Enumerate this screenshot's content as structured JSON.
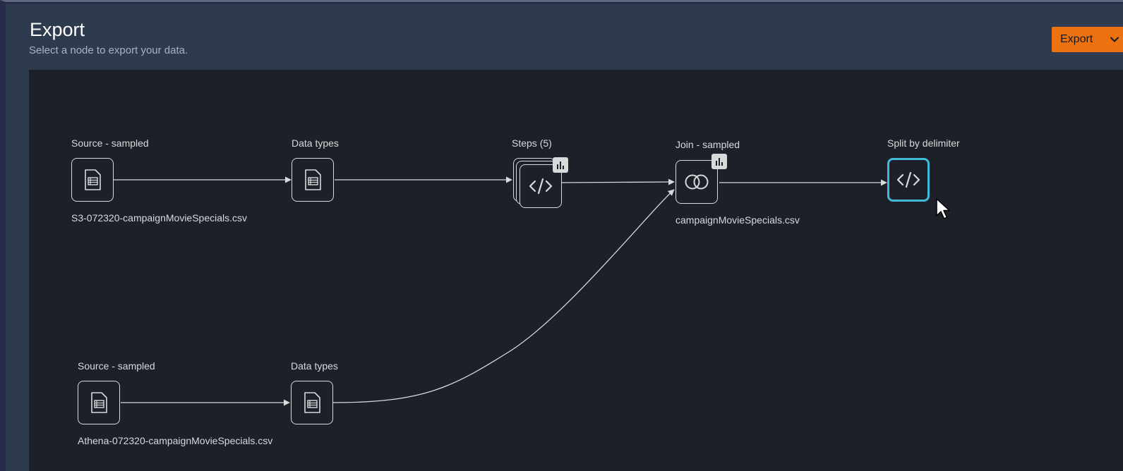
{
  "header": {
    "title": "Export",
    "subtitle": "Select a node to export your data.",
    "export_button_label": "Export"
  },
  "flow": {
    "nodes": [
      {
        "id": "source-1",
        "label": "Source - sampled",
        "caption": "S3-072320-campaignMovieSpecials.csv",
        "icon": "table-document-icon"
      },
      {
        "id": "datatypes-1",
        "label": "Data types",
        "caption": "",
        "icon": "table-document-icon"
      },
      {
        "id": "steps",
        "label": "Steps (5)",
        "caption": "",
        "icon": "code-icon"
      },
      {
        "id": "join",
        "label": "Join - sampled",
        "caption": "campaignMovieSpecials.csv",
        "icon": "join-circles-icon"
      },
      {
        "id": "split",
        "label": "Split by delimiter",
        "caption": "",
        "icon": "code-icon",
        "selected": true
      },
      {
        "id": "source-2",
        "label": "Source - sampled",
        "caption": "Athena-072320-campaignMovieSpecials.csv",
        "icon": "table-document-icon"
      },
      {
        "id": "datatypes-2",
        "label": "Data types",
        "caption": "",
        "icon": "table-document-icon"
      }
    ]
  },
  "colors": {
    "accent": "#ec7211",
    "selected_border": "#44b9d6",
    "canvas_bg": "#1b2029",
    "header_bg": "#2e3b4e"
  }
}
